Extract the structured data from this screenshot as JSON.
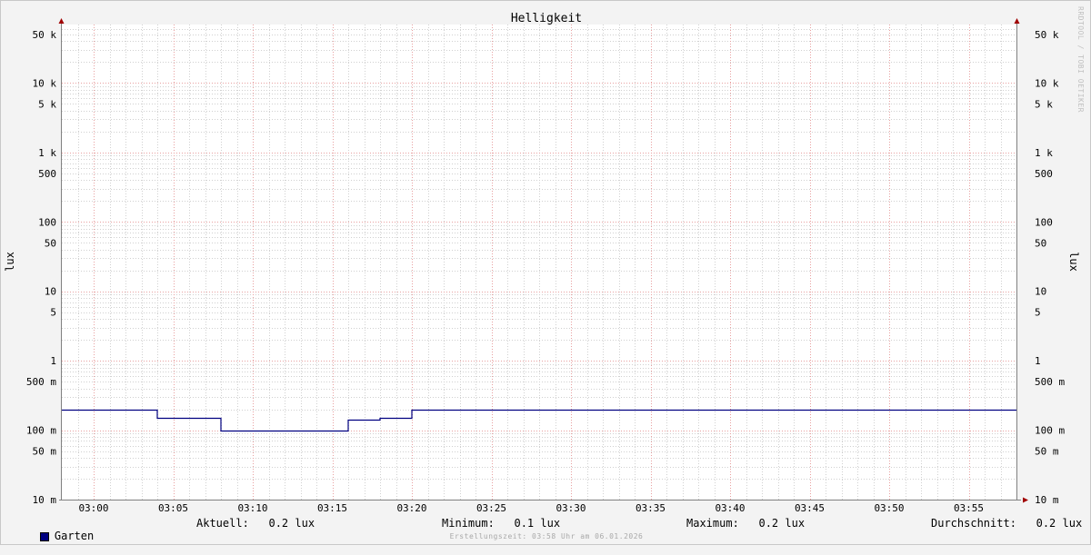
{
  "chart_data": {
    "type": "line",
    "title": "Helligkeit",
    "ylabel": "lux",
    "ylabel_right": "lux",
    "y_scale": "log",
    "ylim": [
      0.01,
      80000
    ],
    "xlim": [
      "02:58",
      "03:58"
    ],
    "x_ticks": [
      "03:00",
      "03:05",
      "03:10",
      "03:15",
      "03:20",
      "03:25",
      "03:30",
      "03:35",
      "03:40",
      "03:45",
      "03:50",
      "03:55"
    ],
    "y_ticks": [
      {
        "value": 50000,
        "label": "50 k"
      },
      {
        "value": 10000,
        "label": "10 k"
      },
      {
        "value": 5000,
        "label": "5 k"
      },
      {
        "value": 1000,
        "label": "1 k"
      },
      {
        "value": 500,
        "label": "500"
      },
      {
        "value": 100,
        "label": "100"
      },
      {
        "value": 50,
        "label": "50"
      },
      {
        "value": 10,
        "label": "10"
      },
      {
        "value": 5,
        "label": "5"
      },
      {
        "value": 1,
        "label": "1"
      },
      {
        "value": 0.5,
        "label": "500 m"
      },
      {
        "value": 0.1,
        "label": "100 m"
      },
      {
        "value": 0.05,
        "label": "50 m"
      },
      {
        "value": 0.01,
        "label": "10 m"
      }
    ],
    "grid": true,
    "series": [
      {
        "name": "Garten",
        "color": "#000080",
        "step": true,
        "points": [
          {
            "x": "02:58",
            "y": 0.2
          },
          {
            "x": "03:04",
            "y": 0.15
          },
          {
            "x": "03:08",
            "y": 0.1
          },
          {
            "x": "03:16",
            "y": 0.14
          },
          {
            "x": "03:18",
            "y": 0.15
          },
          {
            "x": "03:20",
            "y": 0.2
          },
          {
            "x": "03:58",
            "y": 0.2
          }
        ]
      }
    ]
  },
  "legend": {
    "series_name": "Garten",
    "series_color": "#000080",
    "current": "Aktuell:   0.2 lux",
    "minimum": "Minimum:   0.1 lux",
    "maximum": "Maximum:   0.2 lux",
    "average": "Durchschnitt:   0.2 lux"
  },
  "footer": "Erstellungszeit: 03:58 Uhr am 06.01.2026",
  "watermark": "RRDTOOL / TOBI OETIKER",
  "colors": {
    "background": "#f3f3f3",
    "plot": "#ffffff",
    "major_grid": "#e8a0a0",
    "minor_grid": "#d0d0d0",
    "axis": "#808080",
    "arrow": "#a00000"
  }
}
